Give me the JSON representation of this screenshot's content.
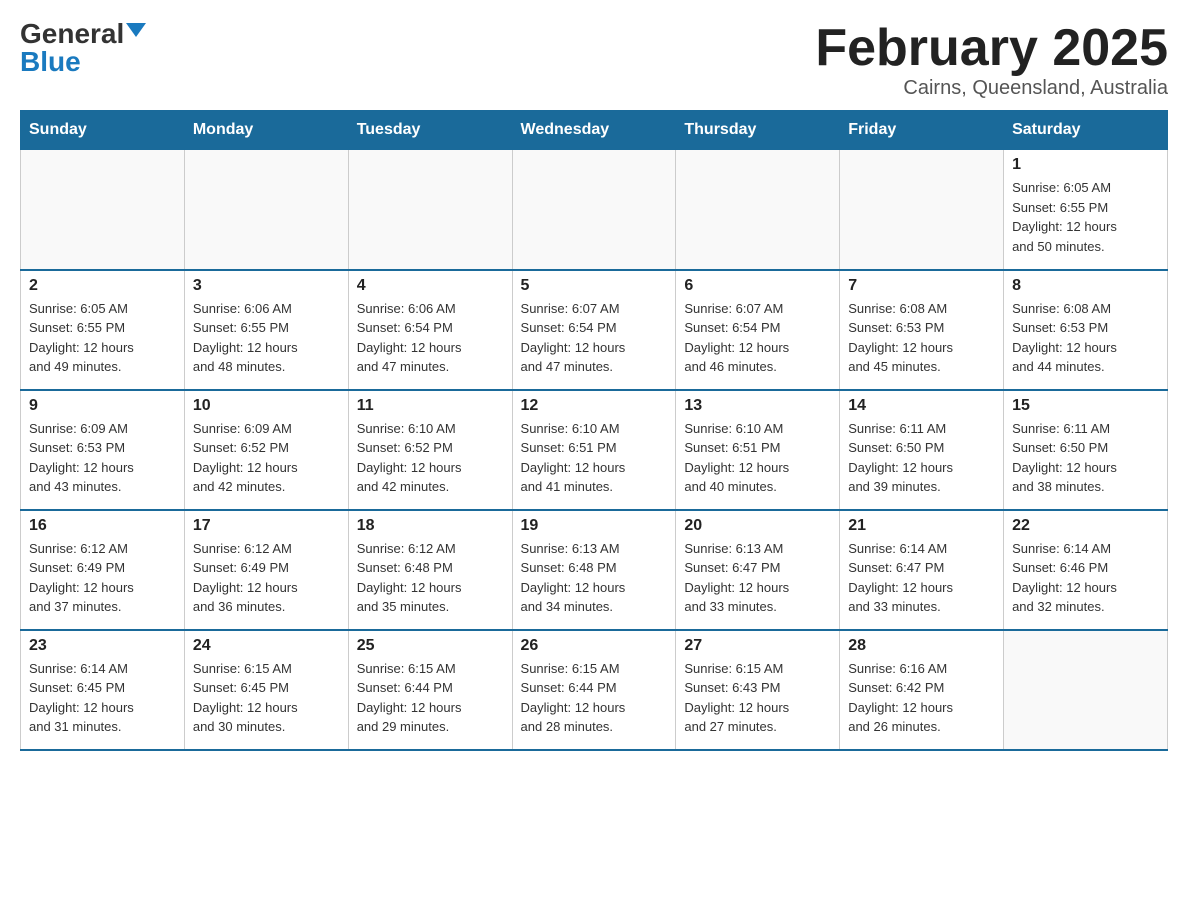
{
  "logo": {
    "general": "General",
    "blue": "Blue"
  },
  "title": "February 2025",
  "subtitle": "Cairns, Queensland, Australia",
  "days_of_week": [
    "Sunday",
    "Monday",
    "Tuesday",
    "Wednesday",
    "Thursday",
    "Friday",
    "Saturday"
  ],
  "weeks": [
    {
      "days": [
        {
          "number": "",
          "info": ""
        },
        {
          "number": "",
          "info": ""
        },
        {
          "number": "",
          "info": ""
        },
        {
          "number": "",
          "info": ""
        },
        {
          "number": "",
          "info": ""
        },
        {
          "number": "",
          "info": ""
        },
        {
          "number": "1",
          "info": "Sunrise: 6:05 AM\nSunset: 6:55 PM\nDaylight: 12 hours\nand 50 minutes."
        }
      ]
    },
    {
      "days": [
        {
          "number": "2",
          "info": "Sunrise: 6:05 AM\nSunset: 6:55 PM\nDaylight: 12 hours\nand 49 minutes."
        },
        {
          "number": "3",
          "info": "Sunrise: 6:06 AM\nSunset: 6:55 PM\nDaylight: 12 hours\nand 48 minutes."
        },
        {
          "number": "4",
          "info": "Sunrise: 6:06 AM\nSunset: 6:54 PM\nDaylight: 12 hours\nand 47 minutes."
        },
        {
          "number": "5",
          "info": "Sunrise: 6:07 AM\nSunset: 6:54 PM\nDaylight: 12 hours\nand 47 minutes."
        },
        {
          "number": "6",
          "info": "Sunrise: 6:07 AM\nSunset: 6:54 PM\nDaylight: 12 hours\nand 46 minutes."
        },
        {
          "number": "7",
          "info": "Sunrise: 6:08 AM\nSunset: 6:53 PM\nDaylight: 12 hours\nand 45 minutes."
        },
        {
          "number": "8",
          "info": "Sunrise: 6:08 AM\nSunset: 6:53 PM\nDaylight: 12 hours\nand 44 minutes."
        }
      ]
    },
    {
      "days": [
        {
          "number": "9",
          "info": "Sunrise: 6:09 AM\nSunset: 6:53 PM\nDaylight: 12 hours\nand 43 minutes."
        },
        {
          "number": "10",
          "info": "Sunrise: 6:09 AM\nSunset: 6:52 PM\nDaylight: 12 hours\nand 42 minutes."
        },
        {
          "number": "11",
          "info": "Sunrise: 6:10 AM\nSunset: 6:52 PM\nDaylight: 12 hours\nand 42 minutes."
        },
        {
          "number": "12",
          "info": "Sunrise: 6:10 AM\nSunset: 6:51 PM\nDaylight: 12 hours\nand 41 minutes."
        },
        {
          "number": "13",
          "info": "Sunrise: 6:10 AM\nSunset: 6:51 PM\nDaylight: 12 hours\nand 40 minutes."
        },
        {
          "number": "14",
          "info": "Sunrise: 6:11 AM\nSunset: 6:50 PM\nDaylight: 12 hours\nand 39 minutes."
        },
        {
          "number": "15",
          "info": "Sunrise: 6:11 AM\nSunset: 6:50 PM\nDaylight: 12 hours\nand 38 minutes."
        }
      ]
    },
    {
      "days": [
        {
          "number": "16",
          "info": "Sunrise: 6:12 AM\nSunset: 6:49 PM\nDaylight: 12 hours\nand 37 minutes."
        },
        {
          "number": "17",
          "info": "Sunrise: 6:12 AM\nSunset: 6:49 PM\nDaylight: 12 hours\nand 36 minutes."
        },
        {
          "number": "18",
          "info": "Sunrise: 6:12 AM\nSunset: 6:48 PM\nDaylight: 12 hours\nand 35 minutes."
        },
        {
          "number": "19",
          "info": "Sunrise: 6:13 AM\nSunset: 6:48 PM\nDaylight: 12 hours\nand 34 minutes."
        },
        {
          "number": "20",
          "info": "Sunrise: 6:13 AM\nSunset: 6:47 PM\nDaylight: 12 hours\nand 33 minutes."
        },
        {
          "number": "21",
          "info": "Sunrise: 6:14 AM\nSunset: 6:47 PM\nDaylight: 12 hours\nand 33 minutes."
        },
        {
          "number": "22",
          "info": "Sunrise: 6:14 AM\nSunset: 6:46 PM\nDaylight: 12 hours\nand 32 minutes."
        }
      ]
    },
    {
      "days": [
        {
          "number": "23",
          "info": "Sunrise: 6:14 AM\nSunset: 6:45 PM\nDaylight: 12 hours\nand 31 minutes."
        },
        {
          "number": "24",
          "info": "Sunrise: 6:15 AM\nSunset: 6:45 PM\nDaylight: 12 hours\nand 30 minutes."
        },
        {
          "number": "25",
          "info": "Sunrise: 6:15 AM\nSunset: 6:44 PM\nDaylight: 12 hours\nand 29 minutes."
        },
        {
          "number": "26",
          "info": "Sunrise: 6:15 AM\nSunset: 6:44 PM\nDaylight: 12 hours\nand 28 minutes."
        },
        {
          "number": "27",
          "info": "Sunrise: 6:15 AM\nSunset: 6:43 PM\nDaylight: 12 hours\nand 27 minutes."
        },
        {
          "number": "28",
          "info": "Sunrise: 6:16 AM\nSunset: 6:42 PM\nDaylight: 12 hours\nand 26 minutes."
        },
        {
          "number": "",
          "info": ""
        }
      ]
    }
  ]
}
